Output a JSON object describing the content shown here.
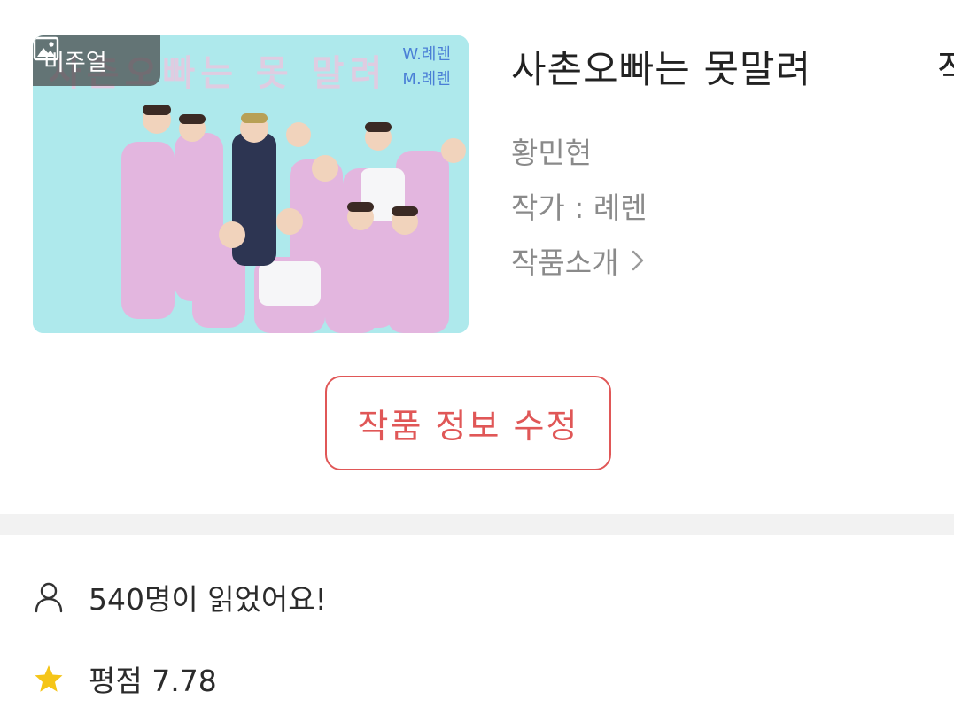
{
  "cover": {
    "badge_label": "비주얼",
    "title_text": "사촌오빠는 못 말려",
    "credit_w": "W.례렌",
    "credit_m": "M.례렌",
    "background_color": "#a9e9ec"
  },
  "work": {
    "title": "사촌오빠는 못말려",
    "title_overflow": "작",
    "subtitle": "황민현",
    "author": "작가 : 례렌",
    "intro_label": "작품소개"
  },
  "actions": {
    "edit_label": "작품 정보 수정",
    "accent_color": "#e05757"
  },
  "stats": {
    "readers": "540명이 읽었어요!",
    "rating": "평점 7.78",
    "star_color": "#f5c518"
  },
  "icons": {
    "badge": "image-icon",
    "intro": "chevron-right-icon",
    "readers": "person-icon",
    "rating": "star-icon"
  }
}
